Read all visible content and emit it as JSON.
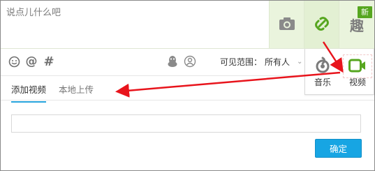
{
  "composer": {
    "placeholder": "说点儿什么吧"
  },
  "tiles": {
    "photo_icon": "camera-icon",
    "link_icon": "link-icon",
    "fun_icon": "fun-icon",
    "fun_glyph": "趣",
    "new_badge": "新"
  },
  "toolbar": {
    "emoji_icon": "smiley-icon",
    "mention_glyph": "@",
    "hashtag_glyph": "#",
    "qq_icon": "qq-penguin-icon",
    "group_icon": "group-icon",
    "visibility_label": "可见范围：",
    "visibility_value": "所有人"
  },
  "media": {
    "music_label": "音乐",
    "video_label": "视频"
  },
  "tabs": [
    {
      "label": "添加视频",
      "active": true
    },
    {
      "label": "本地上传",
      "active": false
    }
  ],
  "video_url_input": {
    "value": ""
  },
  "confirm_label": "确定",
  "colors": {
    "accent": "#17a5e3",
    "green": "#56a61f",
    "tile_bg": "#eaf4dd",
    "arrow": "#e8141c"
  }
}
